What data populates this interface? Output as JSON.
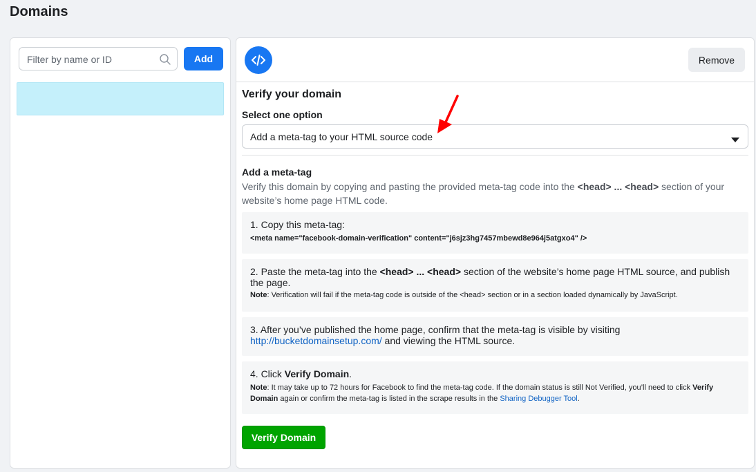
{
  "page": {
    "title": "Domains"
  },
  "sidebar": {
    "search_placeholder": "Filter by name or ID",
    "search_value": "",
    "add_label": "Add"
  },
  "detail": {
    "remove_label": "Remove",
    "verify_title": "Verify your domain",
    "select_label": "Select one option",
    "selected_option": "Add a meta-tag to your HTML source code",
    "meta_title": "Add a meta-tag",
    "meta_desc_1": "Verify this domain by copying and pasting the provided meta-tag code into the ",
    "meta_desc_head": "<head> ... <head>",
    "meta_desc_2": " section of your website’s home page HTML code.",
    "step1_text": "1. Copy this meta-tag:",
    "step1_code": "<meta name=\"facebook-domain-verification\" content=\"j6sjz3hg7457mbewd8e964j5atgxo4\" />",
    "step2_pre": "2. Paste the meta-tag into the ",
    "step2_head": "<head> ... <head>",
    "step2_post": " section of the website’s home page HTML source, and publish the page.",
    "step2_note_label": "Note",
    "step2_note": ": Verification will fail if the meta-tag code is outside of the <head> section or in a section loaded dynamically by JavaScript.",
    "step3_pre": "3. After you’ve published the home page, confirm that the meta-tag is visible by visiting",
    "step3_link": "http://bucketdomainsetup.com/",
    "step3_post": " and viewing the HTML source.",
    "step4_pre": "4. Click ",
    "step4_bold": "Verify Domain",
    "step4_post": ".",
    "step4_note_label": "Note",
    "step4_note_1": ": It may take up to 72 hours for Facebook to find the meta-tag code. If the domain status is still Not Verified, you’ll need to click ",
    "step4_note_bold": "Verify Domain",
    "step4_note_2": " again or confirm the meta-tag is listed in the scrape results in the ",
    "step4_note_link": "Sharing Debugger Tool",
    "step4_note_3": ".",
    "verify_button": "Verify Domain"
  },
  "icons": {
    "search": "search-icon",
    "code": "code-icon",
    "caret": "caret-down-icon",
    "annotation": "red-arrow-icon"
  },
  "colors": {
    "primary": "#1877f2",
    "success": "#00a400",
    "selected_row": "#c5f0fb",
    "link": "#1264c4",
    "annotation": "#ff0000"
  }
}
